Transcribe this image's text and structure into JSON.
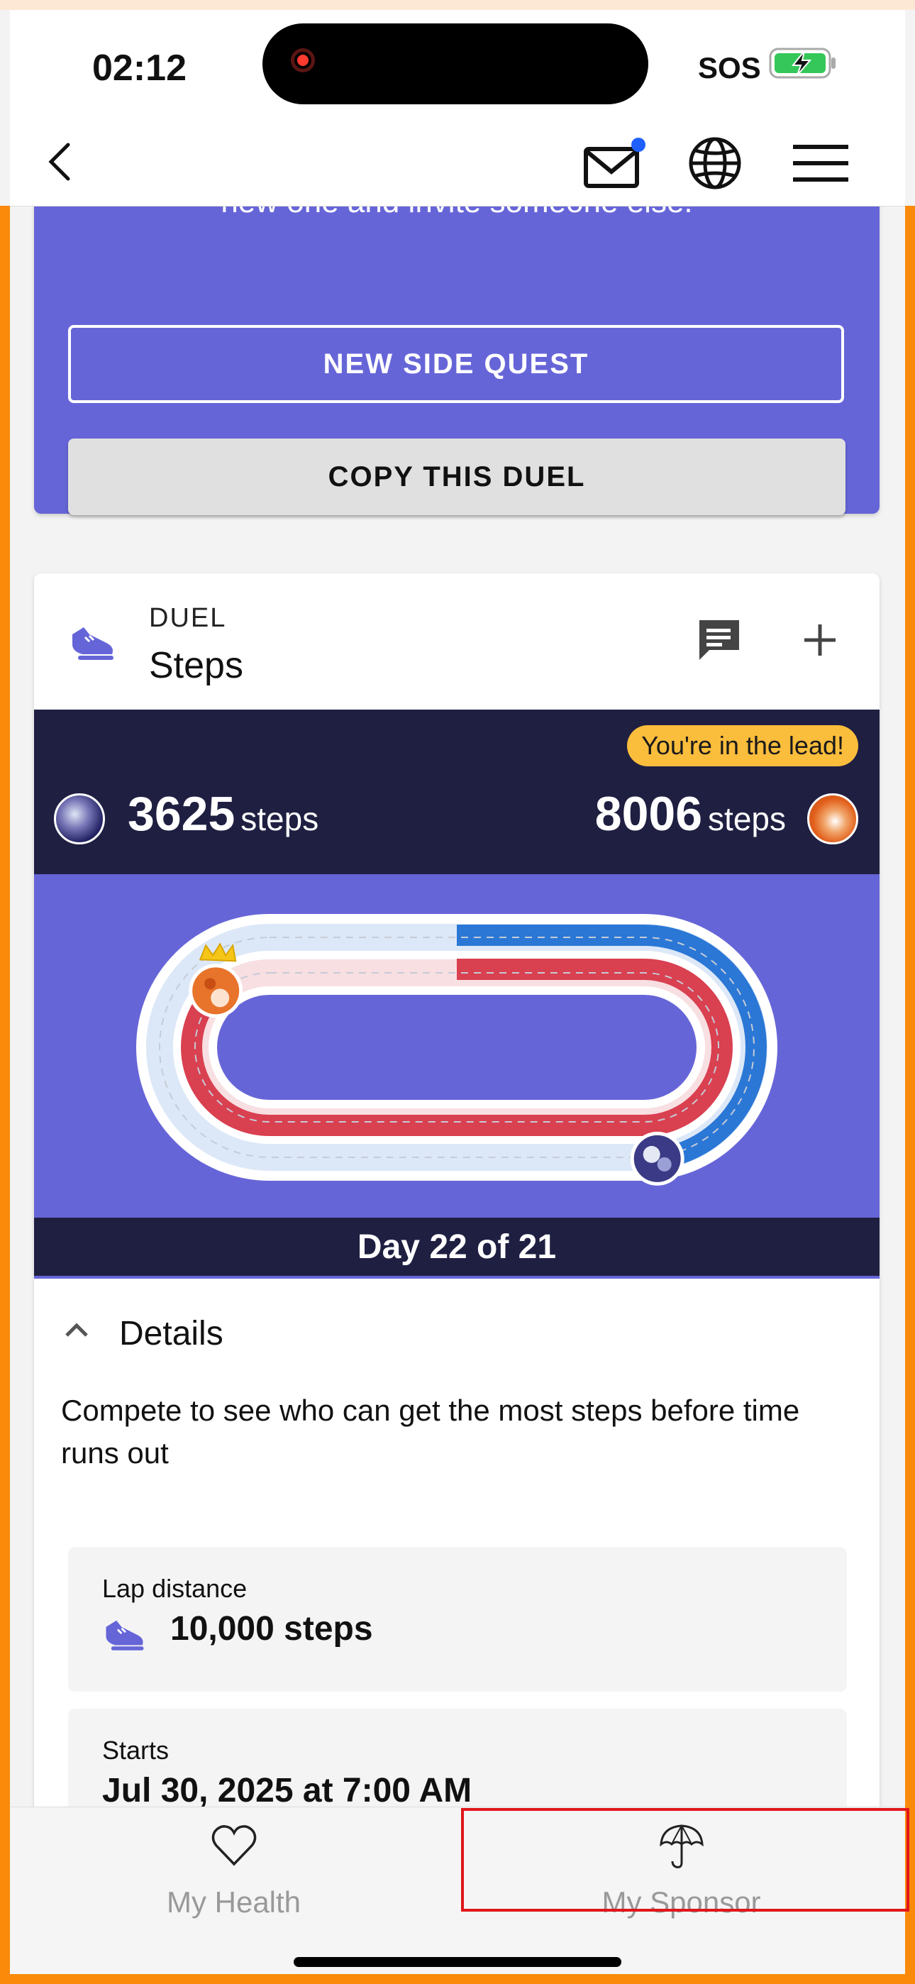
{
  "status_bar": {
    "time": "02:12",
    "sos": "SOS",
    "icons": [
      "record-icon",
      "battery-charging-icon"
    ]
  },
  "header": {
    "icons": [
      "back-icon",
      "mail-icon",
      "globe-icon",
      "menu-icon"
    ]
  },
  "invite_card": {
    "text": "new one and invite someone else.",
    "new_side_quest_label": "NEW SIDE QUEST",
    "copy_duel_label": "COPY THIS DUEL",
    "background_color": "#6665d8"
  },
  "duel": {
    "type_label": "DUEL",
    "name": "Steps",
    "lead_badge": "You're in the lead!",
    "player_left": {
      "steps": "3625",
      "unit": "steps",
      "progress": 0.362
    },
    "player_right": {
      "steps": "8006",
      "unit": "steps",
      "progress": 0.801,
      "leader": true
    },
    "day_label": "Day 22 of 21",
    "details_label": "Details",
    "description": "Compete to see who can get the most steps before time runs out",
    "lap_distance_label": "Lap distance",
    "lap_distance_value": "10,000 steps",
    "starts_label": "Starts",
    "starts_value": "Jul 30, 2025 at 7:00 AM",
    "colors": {
      "track_blue": "#2a77d6",
      "track_red": "#d94050",
      "band": "#1f1f42",
      "badge": "#fbbd3c"
    }
  },
  "bottom_nav": {
    "items": [
      {
        "label": "My Health",
        "icon": "heart-icon"
      },
      {
        "label": "My Sponsor",
        "icon": "umbrella-icon",
        "highlighted": true
      }
    ]
  }
}
